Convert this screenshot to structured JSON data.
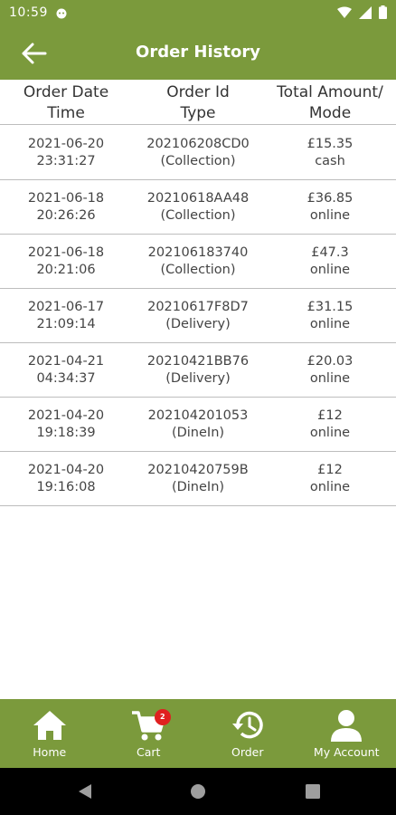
{
  "status_bar": {
    "time": "10:59"
  },
  "header": {
    "title": "Order History"
  },
  "table": {
    "columns": [
      {
        "line1": "Order Date",
        "line2": "Time"
      },
      {
        "line1": "Order Id",
        "line2": "Type"
      },
      {
        "line1": "Total Amount/",
        "line2": "Mode"
      }
    ],
    "rows": [
      {
        "date": "2021-06-20",
        "time": "23:31:27",
        "order_id": "202106208CD0",
        "type": "(Collection)",
        "amount": "£15.35",
        "mode": "cash"
      },
      {
        "date": "2021-06-18",
        "time": "20:26:26",
        "order_id": "20210618AA48",
        "type": "(Collection)",
        "amount": "£36.85",
        "mode": "online"
      },
      {
        "date": "2021-06-18",
        "time": "20:21:06",
        "order_id": "202106183740",
        "type": "(Collection)",
        "amount": "£47.3",
        "mode": "online"
      },
      {
        "date": "2021-06-17",
        "time": "21:09:14",
        "order_id": "20210617F8D7",
        "type": "(Delivery)",
        "amount": "£31.15",
        "mode": "online"
      },
      {
        "date": "2021-04-21",
        "time": "04:34:37",
        "order_id": "20210421BB76",
        "type": "(Delivery)",
        "amount": "£20.03",
        "mode": "online"
      },
      {
        "date": "2021-04-20",
        "time": "19:18:39",
        "order_id": "202104201053",
        "type": "(DineIn)",
        "amount": "£12",
        "mode": "online"
      },
      {
        "date": "2021-04-20",
        "time": "19:16:08",
        "order_id": "20210420759B",
        "type": "(DineIn)",
        "amount": "£12",
        "mode": "online"
      }
    ]
  },
  "bottom_nav": {
    "items": [
      {
        "label": "Home",
        "icon": "home-icon"
      },
      {
        "label": "Cart",
        "icon": "cart-icon",
        "badge": "2"
      },
      {
        "label": "Order",
        "icon": "history-icon"
      },
      {
        "label": "My Account",
        "icon": "account-icon"
      }
    ]
  },
  "colors": {
    "primary": "#7b9a3c",
    "badge": "#e02020",
    "divider": "#bdbdbd"
  }
}
